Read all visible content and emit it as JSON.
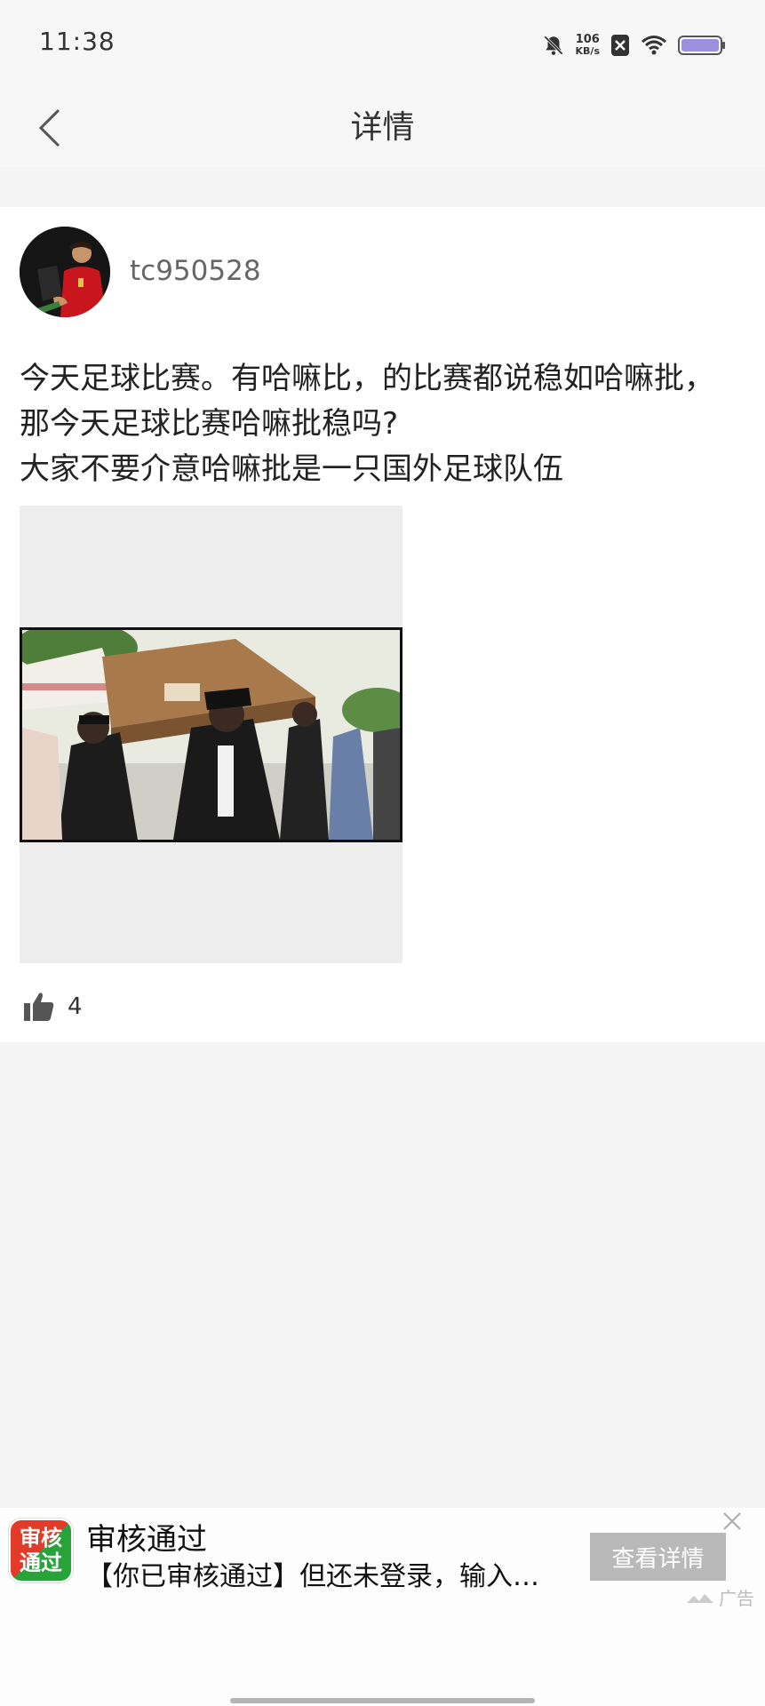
{
  "status_bar": {
    "time": "11:38",
    "speed_value": "106",
    "speed_unit": "KB/s"
  },
  "header": {
    "title": "详情",
    "back_icon": "chevron-left-icon"
  },
  "post": {
    "username": "tc950528",
    "text_lines": [
      "今天足球比赛。有哈嘛比，的比赛都说稳如哈嘛批，",
      "那今天足球比赛哈嘛批稳吗?",
      "大家不要介意哈嘛批是一只国外足球队伍"
    ],
    "like_count": "4",
    "like_icon": "thumbs-up-icon"
  },
  "ad": {
    "logo_line1": "审核",
    "logo_line2": "通过",
    "title": "审核通过",
    "description": "【你已审核通过】但还未登录，输入…",
    "button_label": "查看详情",
    "label": "广告"
  },
  "colors": {
    "background": "#f4f4f4",
    "card": "#ffffff",
    "ad_button": "#b9b9b9"
  }
}
